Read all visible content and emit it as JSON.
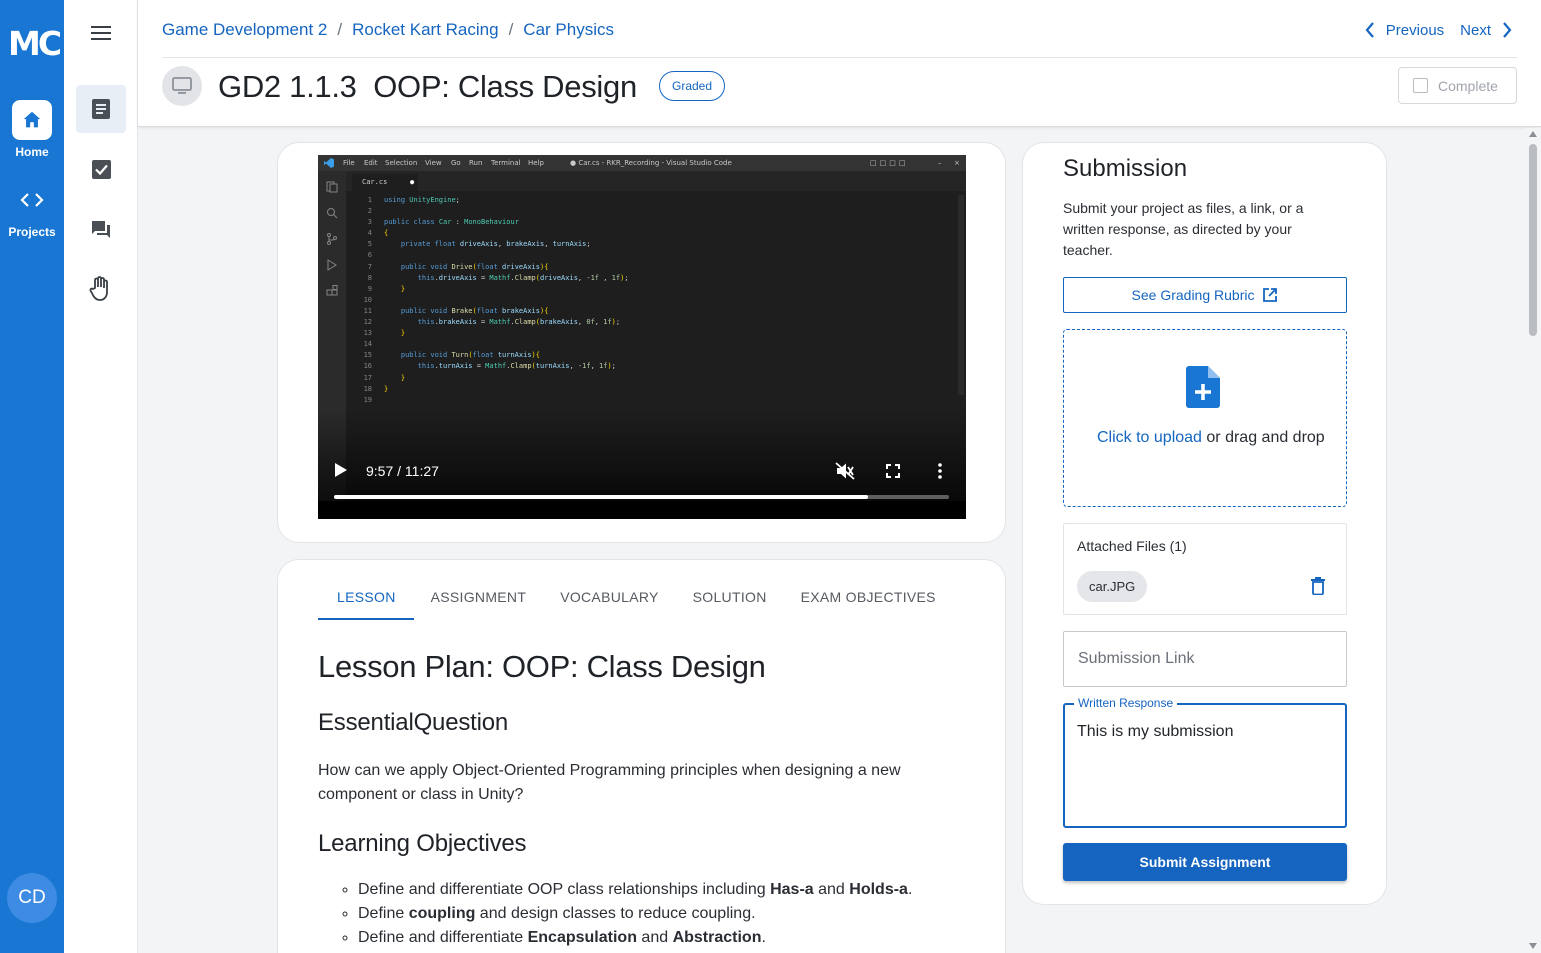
{
  "app": {
    "logo": "MC"
  },
  "rail": {
    "home_label": "Home",
    "projects_label": "Projects",
    "avatar_initials": "CD"
  },
  "breadcrumb": [
    "Game Development 2",
    "Rocket Kart Racing",
    "Car Physics"
  ],
  "nav": {
    "previous": "Previous",
    "next": "Next"
  },
  "page": {
    "title": "GD2 1.1.3  OOP: Class Design",
    "badge": "Graded",
    "complete_label": "Complete"
  },
  "video": {
    "time": "9:57 / 11:27",
    "progress": 0.868,
    "editor": {
      "menu": [
        "File",
        "Edit",
        "Selection",
        "View",
        "Go",
        "Run",
        "Terminal",
        "Help"
      ],
      "window_title": "● Car.cs - RKR_Recording - Visual Studio Code",
      "tab": "Car.cs",
      "code_lines": [
        "using UnityEngine;",
        "",
        "public class Car : MonoBehaviour",
        "{",
        "    private float driveAxis, brakeAxis, turnAxis;",
        "",
        "    public void Drive(float driveAxis){",
        "        this.driveAxis = Mathf.Clamp(driveAxis, -1f , 1f);",
        "    }",
        "",
        "    public void Brake(float brakeAxis){",
        "        this.brakeAxis = Mathf.Clamp(brakeAxis, 0f, 1f);",
        "    }",
        "",
        "    public void Turn(float turnAxis){",
        "        this.turnAxis = Mathf.Clamp(turnAxis, -1f, 1f);",
        "    }",
        "}",
        ""
      ]
    }
  },
  "tabs": [
    {
      "label": "LESSON",
      "active": true
    },
    {
      "label": "ASSIGNMENT",
      "active": false
    },
    {
      "label": "VOCABULARY",
      "active": false
    },
    {
      "label": "SOLUTION",
      "active": false
    },
    {
      "label": "EXAM OBJECTIVES",
      "active": false
    }
  ],
  "lesson": {
    "title": "Lesson Plan: OOP: Class Design",
    "essential_heading": "EssentialQuestion",
    "essential_text": "How can we apply Object-Oriented Programming principles when designing a new component or class in Unity?",
    "objectives_heading": "Learning Objectives",
    "objectives": [
      {
        "pre": "Define and differentiate OOP class relationships including ",
        "b1": "Has-a",
        "mid": " and ",
        "b2": "Holds-a",
        "post": "."
      },
      {
        "pre": "Define ",
        "b1": "coupling",
        "mid": " and design classes to reduce coupling.",
        "b2": "",
        "post": ""
      },
      {
        "pre": "Define and differentiate ",
        "b1": "Encapsulation",
        "mid": " and ",
        "b2": "Abstraction",
        "post": "."
      }
    ]
  },
  "submission": {
    "title": "Submission",
    "description": "Submit your project as files, a link, or a written response, as directed by your teacher.",
    "rubric_label": "See Grading Rubric",
    "upload_link": "Click to upload",
    "upload_rest": " or drag and drop",
    "attached_title": "Attached Files (1)",
    "files": [
      "car.JPG"
    ],
    "link_placeholder": "Submission Link",
    "response_label": "Written Response",
    "response_value": "This is my submission",
    "submit_label": "Submit Assignment"
  }
}
